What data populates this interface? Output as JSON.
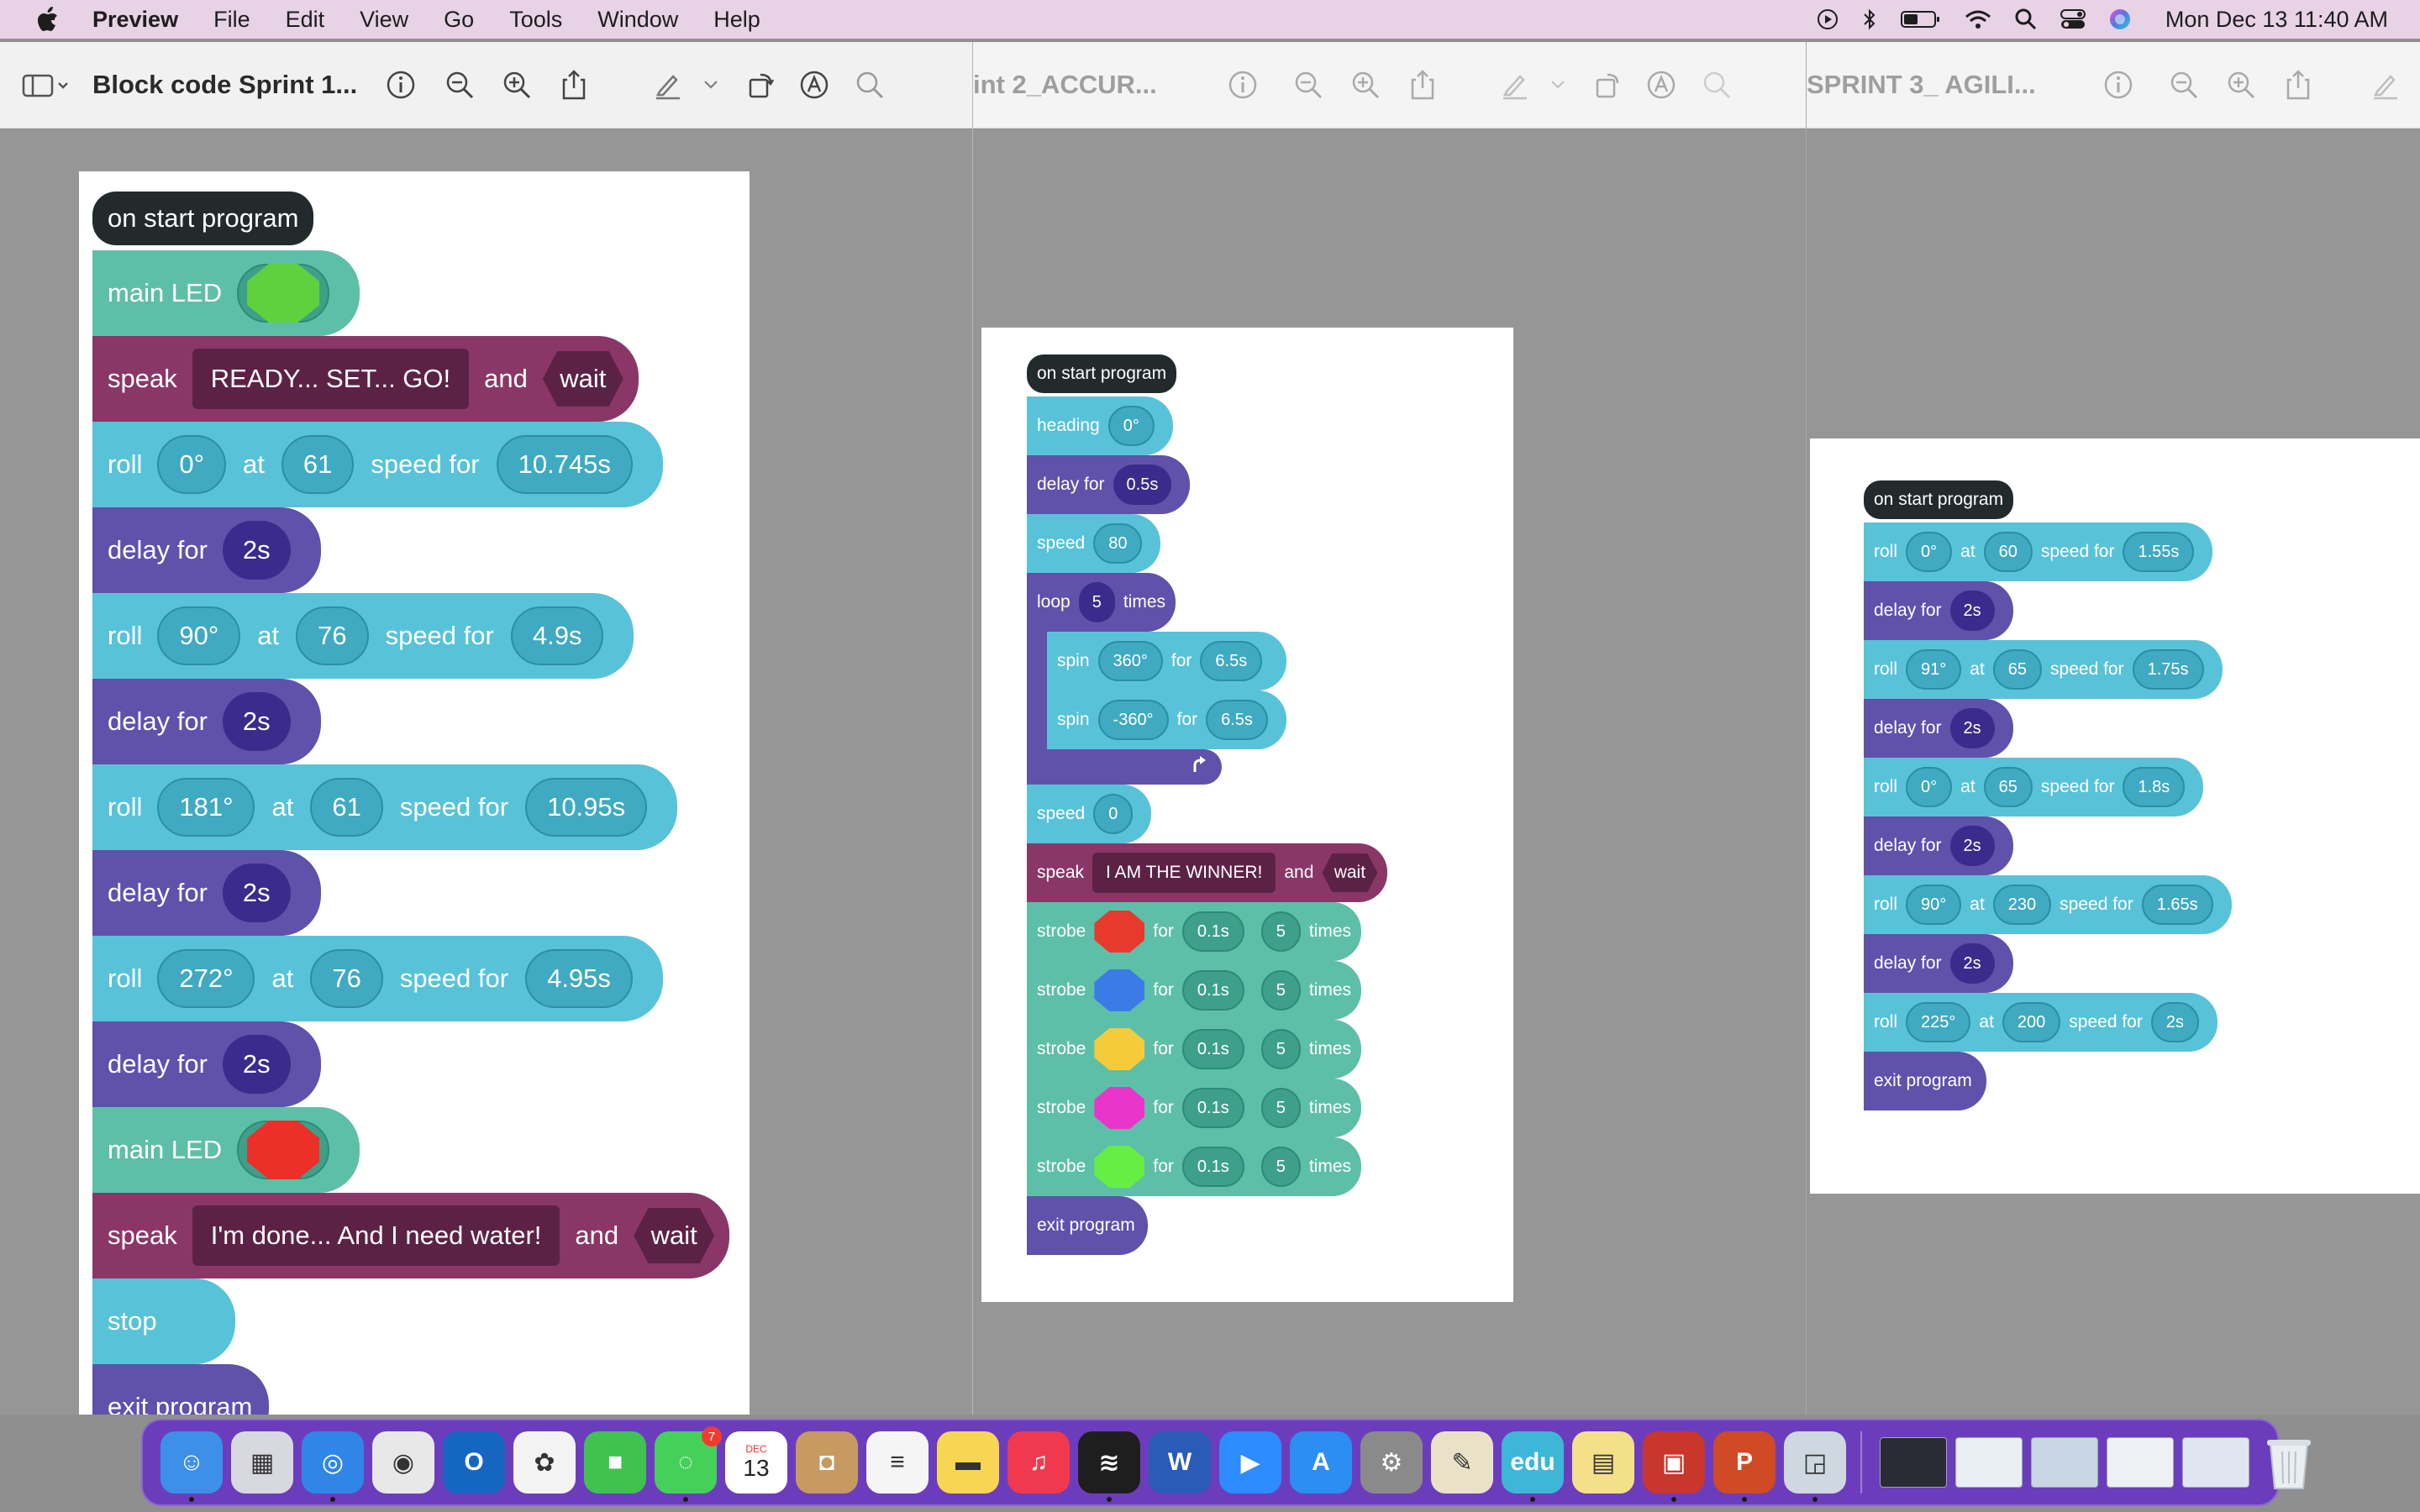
{
  "menubar": {
    "app": "Preview",
    "items": [
      "File",
      "Edit",
      "View",
      "Go",
      "Tools",
      "Window",
      "Help"
    ],
    "clock": "Mon Dec 13  11:40 AM"
  },
  "windows": [
    {
      "title": "Block code Sprint 1..."
    },
    {
      "title": "int 2_ACCUR..."
    },
    {
      "title": "SPRINT 3_ AGILI..."
    }
  ],
  "program1": {
    "start": "on start program",
    "led1": {
      "label": "main LED",
      "color": "#5fd13f"
    },
    "speak1": {
      "label": "speak",
      "text": "READY... SET... GO!",
      "and": "and",
      "wait": "wait"
    },
    "rolls": [
      {
        "label": "roll",
        "heading": "0°",
        "at": "at",
        "speed": "61",
        "speedfor": "speed for",
        "time": "10.745s"
      },
      {
        "label": "roll",
        "heading": "90°",
        "at": "at",
        "speed": "76",
        "speedfor": "speed for",
        "time": "4.9s"
      },
      {
        "label": "roll",
        "heading": "181°",
        "at": "at",
        "speed": "61",
        "speedfor": "speed for",
        "time": "10.95s"
      },
      {
        "label": "roll",
        "heading": "272°",
        "at": "at",
        "speed": "76",
        "speedfor": "speed for",
        "time": "4.95s"
      }
    ],
    "delay": {
      "label": "delay for",
      "value": "2s"
    },
    "led2": {
      "label": "main LED",
      "color": "#ec2f28"
    },
    "speak2": {
      "label": "speak",
      "text": "I'm done... And I need water!",
      "and": "and",
      "wait": "wait"
    },
    "stop": "stop",
    "exit": "exit program"
  },
  "program2": {
    "start": "on start program",
    "heading": {
      "label": "heading",
      "value": "0°"
    },
    "delay": {
      "label": "delay for",
      "value": "0.5s"
    },
    "speed1": {
      "label": "speed",
      "value": "80"
    },
    "loop": {
      "label": "loop",
      "count": "5",
      "times": "times"
    },
    "spin1": {
      "label": "spin",
      "deg": "360°",
      "for": "for",
      "time": "6.5s"
    },
    "spin2": {
      "label": "spin",
      "deg": "-360°",
      "for": "for",
      "time": "6.5s"
    },
    "speed2": {
      "label": "speed",
      "value": "0"
    },
    "speak": {
      "label": "speak",
      "text": "I AM THE WINNER!",
      "and": "and",
      "wait": "wait"
    },
    "strobes": [
      {
        "label": "strobe",
        "color": "#e8392f",
        "for": "for",
        "time": "0.1s",
        "count": "5",
        "times": "times"
      },
      {
        "label": "strobe",
        "color": "#3b7be8",
        "for": "for",
        "time": "0.1s",
        "count": "5",
        "times": "times"
      },
      {
        "label": "strobe",
        "color": "#f4cc3b",
        "for": "for",
        "time": "0.1s",
        "count": "5",
        "times": "times"
      },
      {
        "label": "strobe",
        "color": "#e935c9",
        "for": "for",
        "time": "0.1s",
        "count": "5",
        "times": "times"
      },
      {
        "label": "strobe",
        "color": "#66ee44",
        "for": "for",
        "time": "0.1s",
        "count": "5",
        "times": "times"
      }
    ],
    "exit": "exit program"
  },
  "program3": {
    "start": "on start program",
    "rolls": [
      {
        "label": "roll",
        "heading": "0°",
        "at": "at",
        "speed": "60",
        "speedfor": "speed for",
        "time": "1.55s"
      },
      {
        "label": "roll",
        "heading": "91°",
        "at": "at",
        "speed": "65",
        "speedfor": "speed for",
        "time": "1.75s"
      },
      {
        "label": "roll",
        "heading": "0°",
        "at": "at",
        "speed": "65",
        "speedfor": "speed for",
        "time": "1.8s"
      },
      {
        "label": "roll",
        "heading": "90°",
        "at": "at",
        "speed": "230",
        "speedfor": "speed for",
        "time": "1.65s"
      },
      {
        "label": "roll",
        "heading": "225°",
        "at": "at",
        "speed": "200",
        "speedfor": "speed for",
        "time": "2s"
      }
    ],
    "delay": {
      "label": "delay for",
      "value": "2s"
    },
    "exit": "exit program"
  },
  "dock": {
    "apps": [
      {
        "name": "Finder",
        "color": "#3d8fe8",
        "glyph": "☺"
      },
      {
        "name": "Launchpad",
        "color": "#d8d8e0",
        "glyph": "▦"
      },
      {
        "name": "Safari",
        "color": "#2f86e6",
        "glyph": "◎"
      },
      {
        "name": "Chrome",
        "color": "#e8e8e8",
        "glyph": "◉"
      },
      {
        "name": "Outlook",
        "color": "#1566c0",
        "glyph": "O"
      },
      {
        "name": "Photos",
        "color": "#f3f3f3",
        "glyph": "✿"
      },
      {
        "name": "FaceTime",
        "color": "#3fc24f",
        "glyph": "■"
      },
      {
        "name": "Messages",
        "color": "#45d05a",
        "glyph": "◌",
        "badge": "7"
      },
      {
        "name": "Calendar",
        "color": "#ffffff",
        "glyph": "13",
        "month": "DEC"
      },
      {
        "name": "Contacts",
        "color": "#c79a62",
        "glyph": "◘"
      },
      {
        "name": "Reminders",
        "color": "#f5f5f5",
        "glyph": "≡"
      },
      {
        "name": "Notes",
        "color": "#f6d652",
        "glyph": "▬"
      },
      {
        "name": "Music",
        "color": "#f0394e",
        "glyph": "♫"
      },
      {
        "name": "Spotify",
        "color": "#1e1e1e",
        "glyph": "≋"
      },
      {
        "name": "Word",
        "color": "#2a5bb6",
        "glyph": "W"
      },
      {
        "name": "Zoom",
        "color": "#2d8cff",
        "glyph": "▶"
      },
      {
        "name": "App Store",
        "color": "#2c8ef0",
        "glyph": "A"
      },
      {
        "name": "System Preferences",
        "color": "#8a8a8a",
        "glyph": "⚙"
      },
      {
        "name": "Python",
        "color": "#e9e2c8",
        "glyph": "✎"
      },
      {
        "name": "EdBlocks",
        "color": "#3db6d8",
        "glyph": "edu"
      },
      {
        "name": "Stickies",
        "color": "#f5e08a",
        "glyph": "▤"
      },
      {
        "name": "Photo Booth",
        "color": "#c9362c",
        "glyph": "▣"
      },
      {
        "name": "PowerPoint",
        "color": "#d04a26",
        "glyph": "P"
      },
      {
        "name": "Preview",
        "color": "#cfd8e0",
        "glyph": "◲"
      }
    ],
    "recent": [
      "thumb1",
      "thumb2",
      "thumb3",
      "thumb4",
      "thumb5"
    ],
    "trash": "Trash"
  }
}
